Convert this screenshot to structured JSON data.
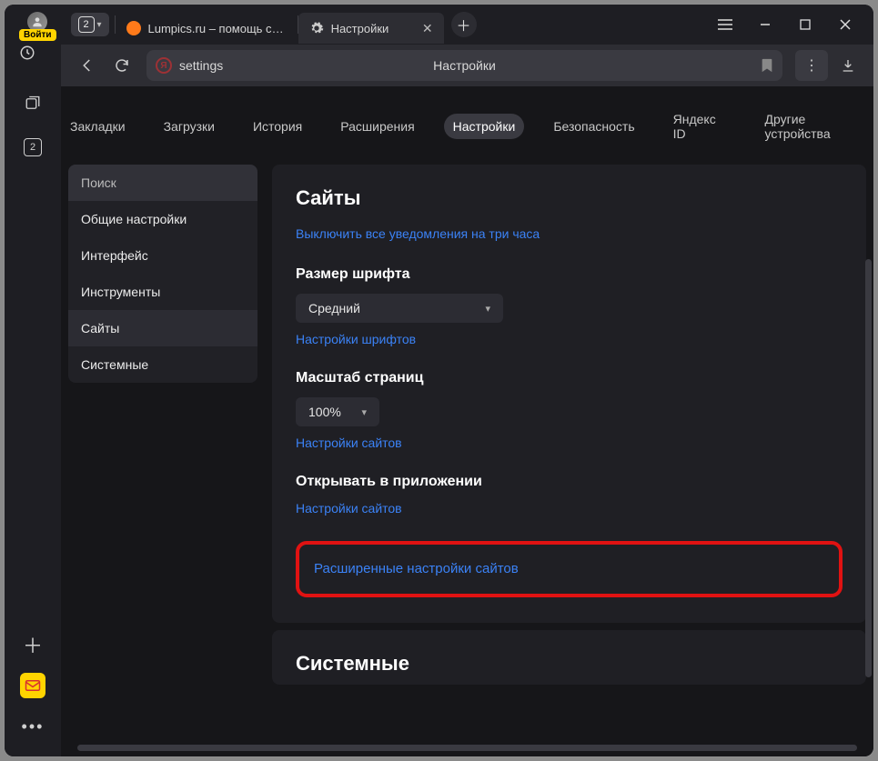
{
  "titlebar": {
    "login_label": "Войти",
    "tab_count": "2",
    "tabs": [
      {
        "label": "Lumpics.ru – помощь с ко",
        "favicon": "orange"
      },
      {
        "label": "Настройки",
        "favicon": "gear"
      }
    ]
  },
  "addressbar": {
    "url_left": "settings",
    "url_center": "Настройки"
  },
  "siderail": {
    "tabcount": "2"
  },
  "topnav": {
    "items": [
      "Закладки",
      "Загрузки",
      "История",
      "Расширения",
      "Настройки",
      "Безопасность",
      "Яндекс ID",
      "Другие устройства"
    ],
    "active_index": 4
  },
  "leftmenu": {
    "search_placeholder": "Поиск",
    "items": [
      "Общие настройки",
      "Интерфейс",
      "Инструменты",
      "Сайты",
      "Системные"
    ],
    "active_index": 3
  },
  "panel_sites": {
    "title": "Сайты",
    "mute_link": "Выключить все уведомления на три часа",
    "font_size_label": "Размер шрифта",
    "font_size_value": "Средний",
    "font_settings_link": "Настройки шрифтов",
    "zoom_label": "Масштаб страниц",
    "zoom_value": "100%",
    "zoom_settings_link": "Настройки сайтов",
    "open_in_app_label": "Открывать в приложении",
    "open_in_app_link": "Настройки сайтов",
    "advanced_link": "Расширенные настройки сайтов"
  },
  "panel_system": {
    "title": "Системные"
  }
}
